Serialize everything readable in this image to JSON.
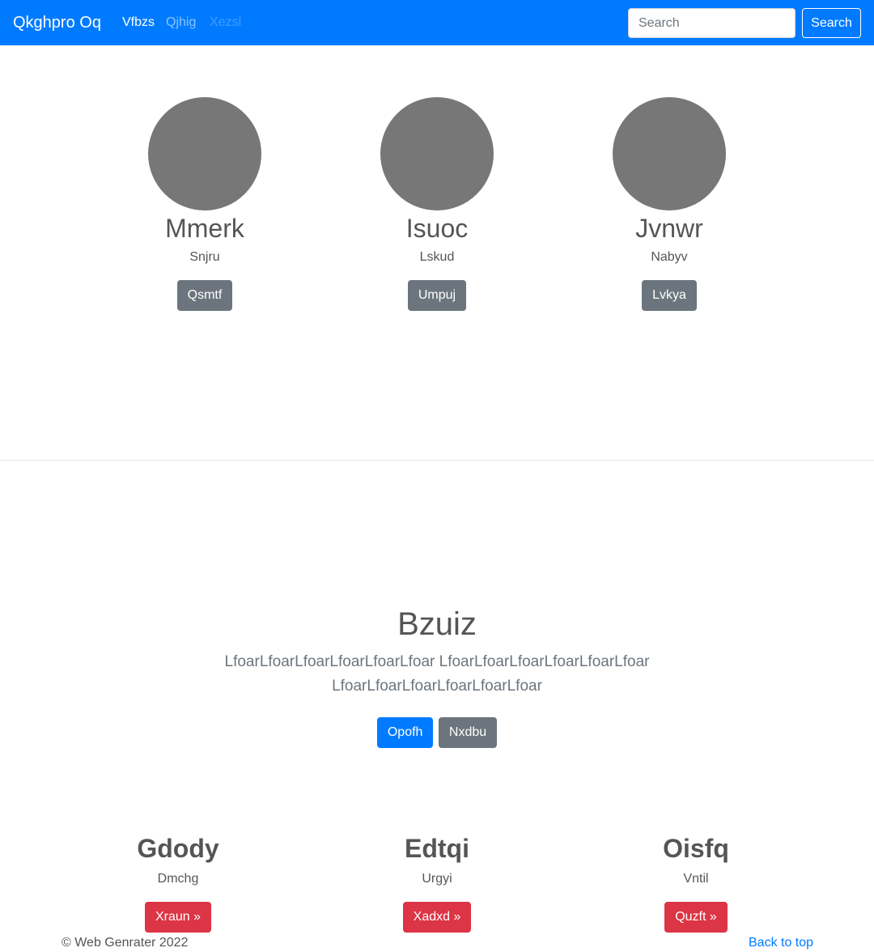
{
  "navbar": {
    "brand": "Qkghpro Oq",
    "links": [
      {
        "label": "Vfbzs",
        "state": "active"
      },
      {
        "label": "Qjhig",
        "state": "normal"
      },
      {
        "label": "Xezsl",
        "state": "disabled"
      }
    ],
    "search": {
      "placeholder": "Search",
      "value": ""
    },
    "search_button": "Search"
  },
  "profiles": [
    {
      "name": "Mmerk",
      "subtitle": "Snjru",
      "button": "Qsmtf"
    },
    {
      "name": "Isuoc",
      "subtitle": "Lskud",
      "button": "Umpuj"
    },
    {
      "name": "Jvnwr",
      "subtitle": "Nabyv",
      "button": "Lvkya"
    }
  ],
  "hero": {
    "title": "Bzuiz",
    "text": "LfoarLfoarLfoarLfoarLfoarLfoar LfoarLfoarLfoarLfoarLfoarLfoar LfoarLfoarLfoarLfoarLfoarLfoar",
    "primary_button": "Opofh",
    "secondary_button": "Nxdbu"
  },
  "features": [
    {
      "title": "Gdody",
      "subtitle": "Dmchg",
      "button": "Xraun »"
    },
    {
      "title": "Edtqi",
      "subtitle": "Urgyi",
      "button": "Xadxd »"
    },
    {
      "title": "Oisfq",
      "subtitle": "Vntil",
      "button": "Quzft »"
    }
  ],
  "footer": {
    "copyright": "© Web Genrater 2022",
    "back_to_top": "Back to top"
  },
  "colors": {
    "primary": "#007bff",
    "secondary": "#6c757d",
    "danger": "#dc3545",
    "avatar": "#777777"
  }
}
